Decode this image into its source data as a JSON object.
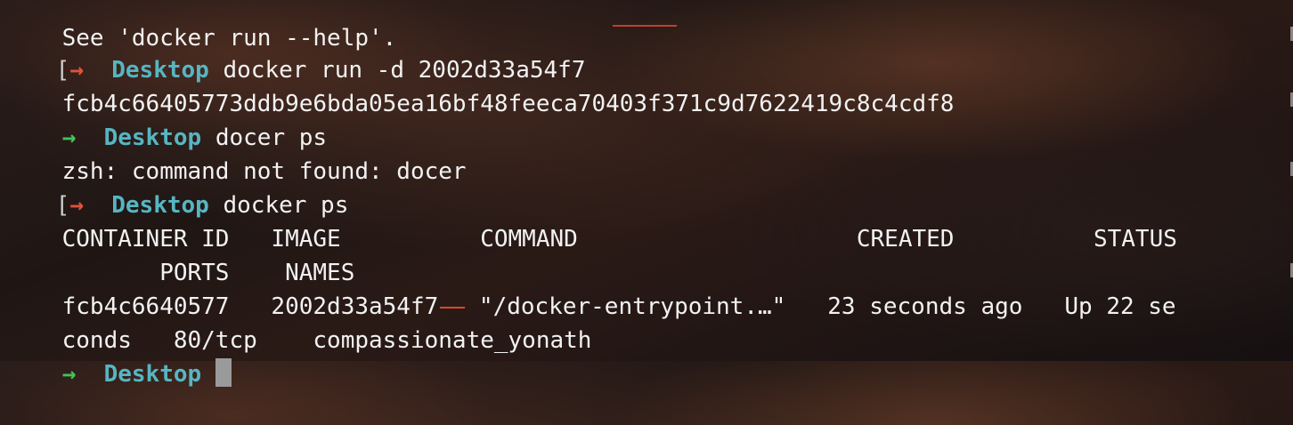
{
  "terminal": {
    "lines": [
      {
        "text": "See 'docker run --help'."
      },
      {
        "arrow": "→",
        "dir": "Desktop",
        "cmd": "docker run -d 2002d33a54f7"
      },
      {
        "text": "fcb4c66405773ddb9e6bda05ea16bf48feeca70403f371c9d7622419c8c4cdf8"
      },
      {
        "arrow": "→",
        "dir": "Desktop",
        "cmd": "docer ps"
      },
      {
        "text": "zsh: command not found: docer"
      },
      {
        "arrow": "→",
        "dir": "Desktop",
        "cmd": "docker ps"
      },
      {
        "text": "CONTAINER ID   IMAGE          COMMAND                    CREATED          STATUS"
      },
      {
        "text": "       PORTS    NAMES"
      },
      {
        "text": "fcb4c6640577   2002d33a54f7",
        "text2": " \"/docker-entrypoint.…\"   23 seconds ago   Up 22 se"
      },
      {
        "text": "conds   80/tcp    compassionate_yonath"
      },
      {
        "arrow": "→",
        "dir": "Desktop",
        "cmd": ""
      }
    ]
  },
  "colors": {
    "arrow_error": "#e0523a",
    "arrow_ok": "#44c25a",
    "directory": "#56b6c2",
    "text": "#f2f2f2"
  }
}
